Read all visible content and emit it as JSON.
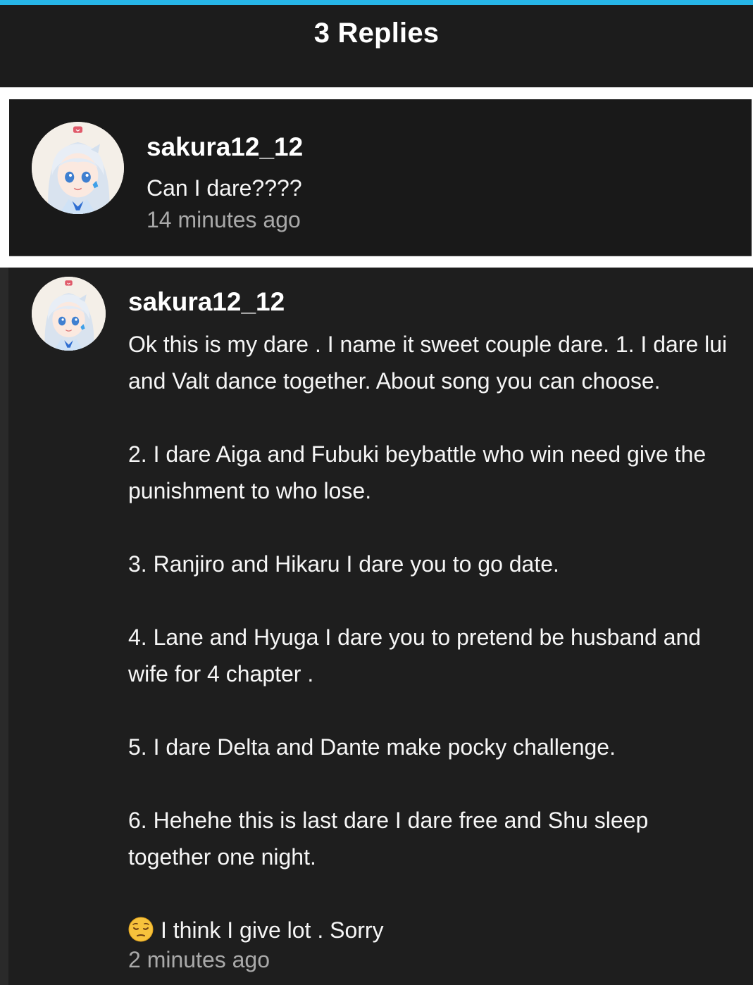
{
  "header": {
    "title": "3 Replies",
    "accent_color": "#27b6e8"
  },
  "parent_comment": {
    "username": "sakura12_12",
    "avatar": "anime-girl-avatar",
    "text": "Can I dare????",
    "time": "14 minutes ago"
  },
  "reply": {
    "username": "sakura12_12",
    "avatar": "anime-girl-avatar",
    "paragraphs": [
      "Ok this is my dare . I name it sweet couple dare. 1. I dare lui and Valt dance together. About song you can choose.",
      "2. I dare Aiga and Fubuki beybattle who win need give the punishment to who lose.",
      "3. Ranjiro and Hikaru I dare you to go date.",
      "4. Lane and Hyuga I dare you to pretend be husband and wife for 4 chapter .",
      "5. I dare Delta and Dante make pocky challenge.",
      "6. Hehehe this is last dare I dare free and Shu sleep together one night."
    ],
    "closing_emoji": "pensive-face-icon",
    "closing_text": "I think I give lot . Sorry",
    "time": "2 minutes ago"
  }
}
